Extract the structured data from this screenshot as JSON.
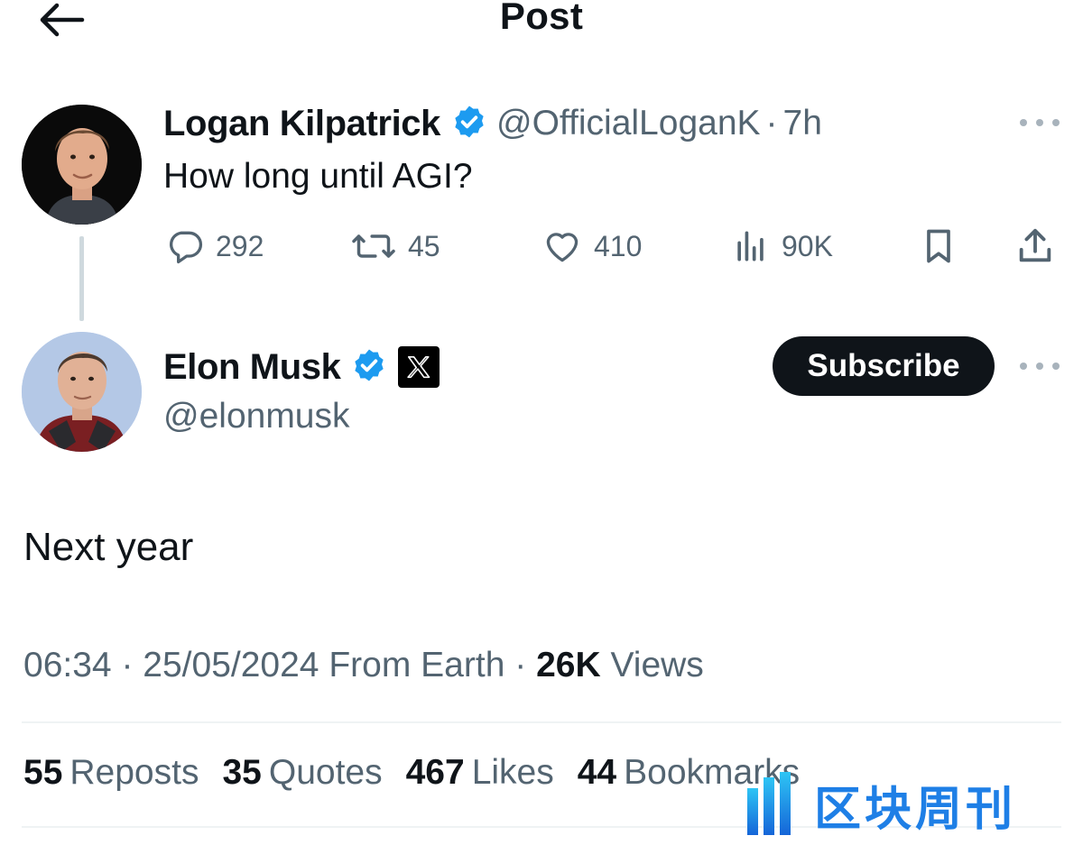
{
  "header": {
    "title": "Post"
  },
  "parent_post": {
    "author_name": "Logan Kilpatrick",
    "handle": "@OfficialLoganK",
    "separator": "·",
    "time": "7h",
    "text": "How long until AGI?",
    "replies": "292",
    "reposts": "45",
    "likes": "410",
    "views": "90K"
  },
  "main_post": {
    "author_name": "Elon Musk",
    "handle": "@elonmusk",
    "subscribe_label": "Subscribe",
    "text": "Next year",
    "time": "06:34",
    "date": "25/05/2024",
    "source": "From Earth",
    "views_count": "26K",
    "views_label": "Views",
    "separator": "·"
  },
  "stats": {
    "reposts_count": "55",
    "reposts_label": "Reposts",
    "quotes_count": "35",
    "quotes_label": "Quotes",
    "likes_count": "467",
    "likes_label": "Likes",
    "bookmarks_count": "44",
    "bookmarks_label": "Bookmarks"
  },
  "watermark": {
    "text": "区块周刊"
  },
  "colors": {
    "text_primary": "#0f1419",
    "text_secondary": "#536471",
    "verified_blue": "#1d9bf0",
    "button_dark": "#0f1419",
    "watermark_blue": "#1e7fe6"
  },
  "icons": [
    "back-arrow-icon",
    "verified-icon",
    "x-logo-icon",
    "more-icon",
    "reply-icon",
    "repost-icon",
    "like-icon",
    "views-icon",
    "bookmark-icon",
    "share-icon"
  ]
}
